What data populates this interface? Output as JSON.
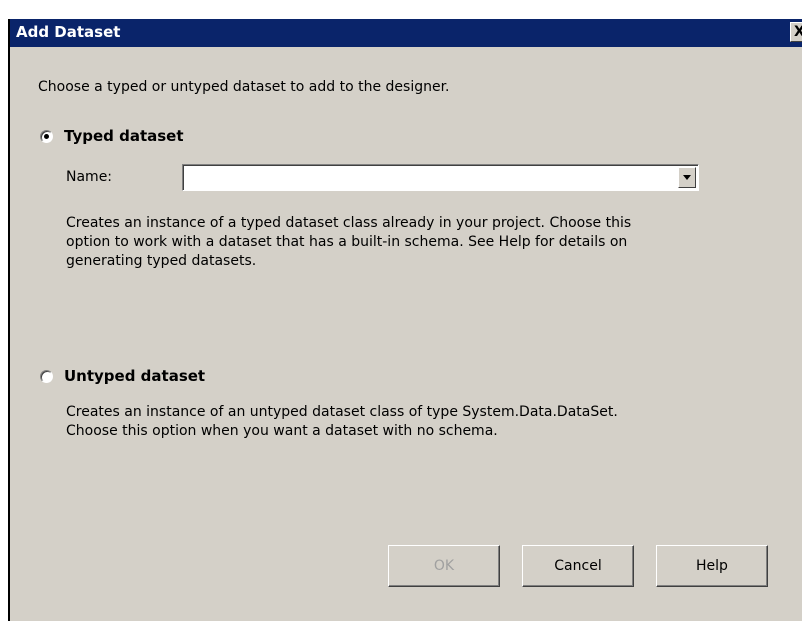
{
  "dialog": {
    "title": "Add Dataset",
    "close_label": "X",
    "intro": "Choose a typed or untyped dataset to add to the designer.",
    "typed": {
      "label": "Typed dataset",
      "selected": true,
      "name_label": "Name:",
      "name_value": "",
      "description_lines": [
        "Creates an instance of a typed dataset class already in your project. Choose this",
        "option to work with a dataset that has a built-in schema. See Help for details on",
        "generating typed datasets."
      ]
    },
    "untyped": {
      "label": "Untyped dataset",
      "selected": false,
      "description_lines": [
        "Creates an instance of an untyped dataset class of type System.Data.DataSet.",
        "Choose this option when you want a dataset with no schema."
      ]
    },
    "buttons": {
      "ok": "OK",
      "cancel": "Cancel",
      "help": "Help"
    }
  }
}
